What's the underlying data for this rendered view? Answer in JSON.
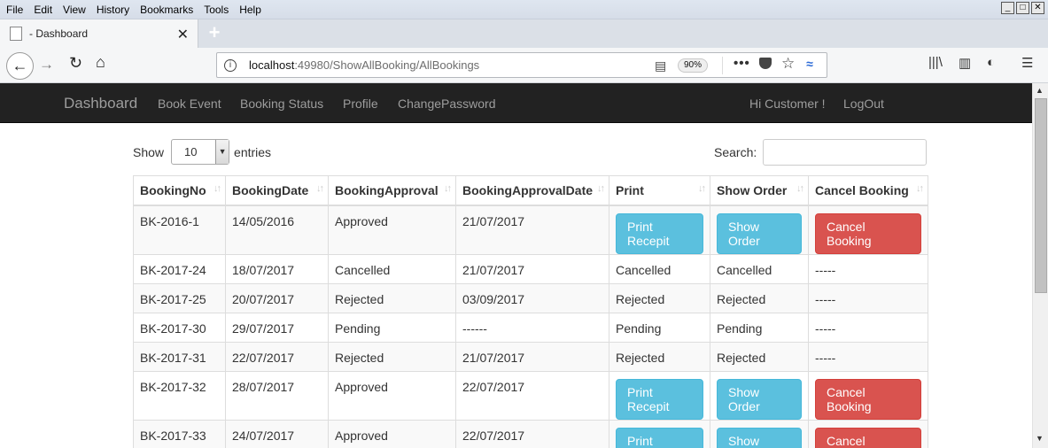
{
  "menu": [
    "File",
    "Edit",
    "View",
    "History",
    "Bookmarks",
    "Tools",
    "Help"
  ],
  "tab": {
    "title": "- Dashboard"
  },
  "url": {
    "host": "localhost",
    "path": ":49980/ShowAllBooking/AllBookings",
    "zoom": "90%"
  },
  "nav": {
    "brand": "Dashboard",
    "links": [
      "Book Event",
      "Booking Status",
      "Profile",
      "ChangePassword"
    ],
    "greeting": "Hi Customer !",
    "logout": "LogOut"
  },
  "table_controls": {
    "show_label": "Show",
    "entries_value": "10",
    "entries_label": "entries",
    "search_label": "Search:"
  },
  "columns": [
    "BookingNo",
    "BookingDate",
    "BookingApproval",
    "BookingApprovalDate",
    "Print",
    "Show Order",
    "Cancel Booking"
  ],
  "buttons": {
    "print": "Print Recepit",
    "show": "Show Order",
    "cancel": "Cancel Booking"
  },
  "rows": [
    {
      "no": "BK-2016-1",
      "date": "14/05/2016",
      "approval": "Approved",
      "approval_date": "21/07/2017",
      "print": "",
      "show": "",
      "cancel": "",
      "actions": true
    },
    {
      "no": "BK-2017-24",
      "date": "18/07/2017",
      "approval": "Cancelled",
      "approval_date": "21/07/2017",
      "print": "Cancelled",
      "show": "Cancelled",
      "cancel": "-----",
      "actions": false
    },
    {
      "no": "BK-2017-25",
      "date": "20/07/2017",
      "approval": "Rejected",
      "approval_date": "03/09/2017",
      "print": "Rejected",
      "show": "Rejected",
      "cancel": "-----",
      "actions": false
    },
    {
      "no": "BK-2017-30",
      "date": "29/07/2017",
      "approval": "Pending",
      "approval_date": "------",
      "print": "Pending",
      "show": "Pending",
      "cancel": "-----",
      "actions": false
    },
    {
      "no": "BK-2017-31",
      "date": "22/07/2017",
      "approval": "Rejected",
      "approval_date": "21/07/2017",
      "print": "Rejected",
      "show": "Rejected",
      "cancel": "-----",
      "actions": false
    },
    {
      "no": "BK-2017-32",
      "date": "28/07/2017",
      "approval": "Approved",
      "approval_date": "22/07/2017",
      "print": "",
      "show": "",
      "cancel": "",
      "actions": true
    },
    {
      "no": "BK-2017-33",
      "date": "24/07/2017",
      "approval": "Approved",
      "approval_date": "22/07/2017",
      "print": "",
      "show": "",
      "cancel": "",
      "actions": true
    }
  ],
  "colors": {
    "navbar": "#222222",
    "info": "#5bc0de",
    "danger": "#d9534f"
  }
}
